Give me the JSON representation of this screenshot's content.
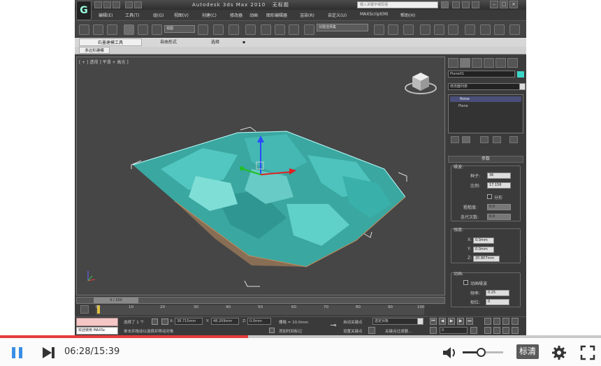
{
  "titlebar": {
    "app_title": "Autodesk 3ds Max  2010",
    "file_name": "无标题",
    "search_placeholder": "键入关键字或短语"
  },
  "menu": [
    "编辑(E)",
    "工具(T)",
    "组(G)",
    "视图(V)",
    "创建(C)",
    "修改器",
    "动画",
    "图形编辑器",
    "渲染(R)",
    "自定义(U)",
    "MAXScript(M)",
    "帮助(H)"
  ],
  "toolbar": {
    "selection_filter": "全部",
    "view_dropdown": "视图",
    "named_set": "创建选择集"
  },
  "ribbon": {
    "tabs": [
      "石墨建模工具",
      "自由形式",
      "选择",
      "▪"
    ],
    "subtab": "多边形建模"
  },
  "viewport": {
    "label": "[ + ] 透视 ] 平滑 + 高光 ]"
  },
  "panel": {
    "object_name": "Plane01",
    "modifier_list": "修改器列表",
    "stack_items": [
      "Noise",
      "Plane"
    ],
    "rollout_title": "参数",
    "noise_group": "噪波:",
    "seed_label": "种子:",
    "seed_value": "36",
    "scale_label": "比例:",
    "scale_value": "17.156",
    "fractal_label": "分形",
    "roughness_label": "粗糙度:",
    "roughness_value": "0.0",
    "iterations_label": "迭代次数:",
    "iterations_value": "6.0",
    "strength_group": "强度:",
    "x_label": "X:",
    "x_value": "0.0mm",
    "y_label": "Y:",
    "y_value": "0.0mm",
    "z_label": "Z:",
    "z_value": "20.807mm",
    "animation_group": "动画:",
    "animate_noise_label": "动画噪波",
    "frequency_label": "频率:",
    "frequency_value": "0.25",
    "phase_label": "相位:",
    "phase_value": "0"
  },
  "timeline": {
    "frame_counter": "0 / 100",
    "ticks": [
      "0",
      "10",
      "20",
      "30",
      "40",
      "50",
      "60",
      "70",
      "80",
      "90",
      "100"
    ]
  },
  "status": {
    "welcome": "欢迎使用 MAXSc",
    "selected": "选择了 1 个",
    "x_label": "X:",
    "x_value": "38.715mm",
    "y_label": "Y:",
    "y_value": "48.209mm",
    "z_label": "Z:",
    "z_value": "0.0mm",
    "grid": "栅格 = 10.0mm",
    "prompt": "单击并拖动以选择并移动对象",
    "add_time_tag": "添加时间标记",
    "auto_key": "自动关键点",
    "set_key": "设置关键点",
    "selected_object": "选定对象",
    "key_filters": "关键点过滤器...",
    "current_frame": "0"
  },
  "player": {
    "time": "06:28/15:39",
    "progress": 0.413,
    "volume": 0.45,
    "quality": "标清",
    "accent_color": "#e53d3d"
  }
}
